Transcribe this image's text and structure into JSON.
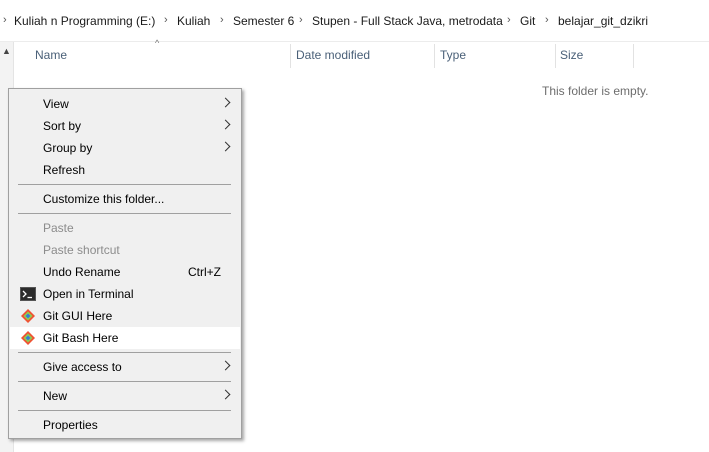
{
  "breadcrumb": [
    "Kuliah n Programming (E:)",
    "Kuliah",
    "Semester 6",
    "Stupen - Full Stack Java, metrodata",
    "Git",
    "belajar_git_dzikri"
  ],
  "columns": {
    "name": "Name",
    "date_modified": "Date modified",
    "type": "Type",
    "size": "Size"
  },
  "empty_message": "This folder is empty.",
  "context_menu": {
    "view": "View",
    "sort_by": "Sort by",
    "group_by": "Group by",
    "refresh": "Refresh",
    "customize": "Customize this folder...",
    "paste": "Paste",
    "paste_shortcut": "Paste shortcut",
    "undo_rename": "Undo Rename",
    "undo_shortcut": "Ctrl+Z",
    "open_terminal": "Open in Terminal",
    "git_gui": "Git GUI Here",
    "git_bash": "Git Bash Here",
    "give_access": "Give access to",
    "new": "New",
    "properties": "Properties"
  },
  "colors": {
    "menu_bg": "#f0f0f0",
    "menu_highlight": "#ffffff",
    "disabled_text": "#8c8c8c",
    "header_text": "#4a6078"
  },
  "icons": {
    "terminal": "terminal-icon",
    "git": "git-diamond-icon"
  }
}
